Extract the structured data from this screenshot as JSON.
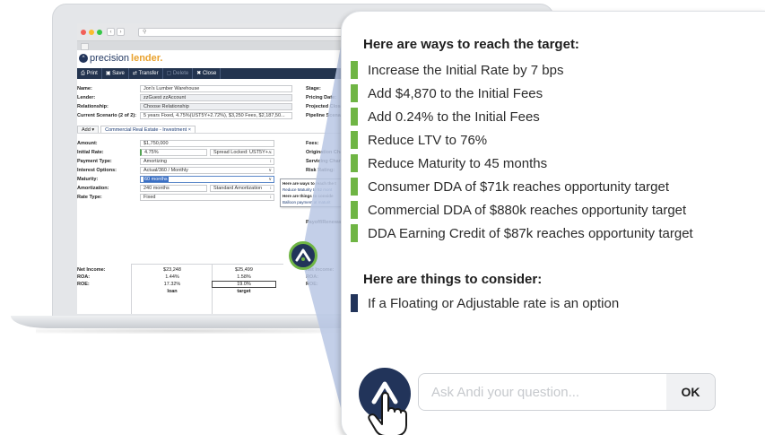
{
  "app": {
    "logo_prefix": "precision",
    "logo_suffix": "lender."
  },
  "toolbar": {
    "print": "Print",
    "save": "Save",
    "transfer": "Transfer",
    "delete": "Delete",
    "close": "Close"
  },
  "header_form": [
    {
      "label": "Name:",
      "value": "Jon's Lumber Warehouse",
      "right": "Stage:"
    },
    {
      "label": "Lender:",
      "value": "zzGuest zzAccount",
      "right": "Pricing Date:"
    },
    {
      "label": "Relationship:",
      "value": "Choose Relationship",
      "right": "Projected Close"
    },
    {
      "label": "Current Scenario (2 of 2):",
      "value": "5 years Fixed, 4.75%(UST5Y+2.72%), $3,250 Fees, $2,187,50...",
      "right": "Pipeline Scenari"
    }
  ],
  "subtabs": {
    "add": "Add",
    "active": "Commercial Real Estate - Investment"
  },
  "loan_form": {
    "amount_label": "Amount:",
    "amount": "$1,750,000",
    "initial_rate_label": "Initial Rate:",
    "initial_rate": "4.75%",
    "spread": "Spread Locked: UST5Y+...",
    "payment_type_label": "Payment Type:",
    "payment_type": "Amortizing",
    "interest_options_label": "Interest Options:",
    "interest_options": "Actual/360 / Monthly",
    "maturity_label": "Maturity:",
    "maturity": "60 months",
    "amortization_label": "Amortization:",
    "amortization": "240 months",
    "amortization_type": "Standard Amortization",
    "rate_type_label": "Rate Type:",
    "rate_type": "Fixed",
    "right_labels": [
      "Fees:",
      "Origination Char",
      "Servicing Charg",
      "Risk Rating:"
    ],
    "payoff_label": "Payoff/Renewal:"
  },
  "tooltip": {
    "head1": "Here are ways to reach the t",
    "item1": "Reduce Maturity to 52 mont",
    "head2": "Here are things to conside",
    "item2": "Balloon payment at maturit"
  },
  "summary": {
    "rows": [
      {
        "label": "Net Income:",
        "loan": "$23,248",
        "target": "$25,499",
        "right": "Net Income:"
      },
      {
        "label": "ROA:",
        "loan": "1.44%",
        "target": "1.58%",
        "right": "ROA:"
      },
      {
        "label": "ROE:",
        "loan": "17.32%",
        "target": "19.0%",
        "right": "ROE:"
      }
    ],
    "col_loan": "loan",
    "col_target": "target"
  },
  "panel": {
    "heading_ways": "Here are ways to reach the target:",
    "suggestions": [
      "Increase the Initial Rate by 7 bps",
      "Add $4,870 to the Initial Fees",
      "Add 0.24% to the Initial Fees",
      "Reduce LTV to 76%",
      "Reduce Maturity to 45 months",
      "Consumer DDA of $71k reaches opportunity target",
      "Commercial DDA of $880k reaches opportunity target",
      "DDA Earning Credit of $87k reaches opportunity target"
    ],
    "heading_consider": "Here are things to consider:",
    "considerations": [
      "If a Floating or Adjustable rate is an option"
    ],
    "ask_placeholder": "Ask Andi your question...",
    "ask_value": "",
    "ok_label": "OK"
  },
  "colors": {
    "navy": "#22345a",
    "green": "#6fb544",
    "orange": "#e9a22e",
    "beam": "#b9c7e4"
  }
}
